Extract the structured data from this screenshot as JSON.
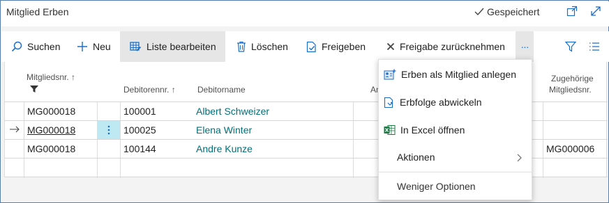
{
  "page": {
    "title": "Mitglied Erben",
    "status": "Gespeichert"
  },
  "toolbar": {
    "search": "Suchen",
    "new": "Neu",
    "edit_list": "Liste bearbeiten",
    "delete": "Löschen",
    "release": "Freigeben",
    "revoke_release": "Freigabe zurücknehmen",
    "more": "···"
  },
  "columns": {
    "member_no": "Mitgliedsnr. ↑",
    "debtor_no": "Debitorennr. ↑",
    "debtor_name": "Debitorname",
    "partial_hidden": "An",
    "assoc_member_line1": "Zugehörige",
    "assoc_member_line2": "Mitgliedsnr."
  },
  "rows": [
    {
      "member_no": "MG000018",
      "debtor_no": "100001",
      "debtor_name": "Albert Schweizer",
      "assoc_member_no": ""
    },
    {
      "member_no": "MG000018",
      "debtor_no": "100025",
      "debtor_name": "Elena Winter",
      "assoc_member_no": ""
    },
    {
      "member_no": "MG000018",
      "debtor_no": "100144",
      "debtor_name": "Andre Kunze",
      "assoc_member_no": "MG000006"
    }
  ],
  "menu": {
    "items": [
      {
        "label": "Erben als Mitglied anlegen",
        "icon": "add-member-icon"
      },
      {
        "label": "Erbfolge abwickeln",
        "icon": "process-document-icon"
      },
      {
        "label": "In Excel öffnen",
        "icon": "excel-icon"
      },
      {
        "label": "Aktionen",
        "icon": "chevron-right-icon"
      },
      {
        "label": "Weniger Optionen",
        "icon": ""
      }
    ]
  },
  "colors": {
    "link": "#00707a",
    "accent": "#1a6ec7",
    "selected_cell": "#bfe9f2",
    "active_button_bg": "#e6e6e6"
  }
}
